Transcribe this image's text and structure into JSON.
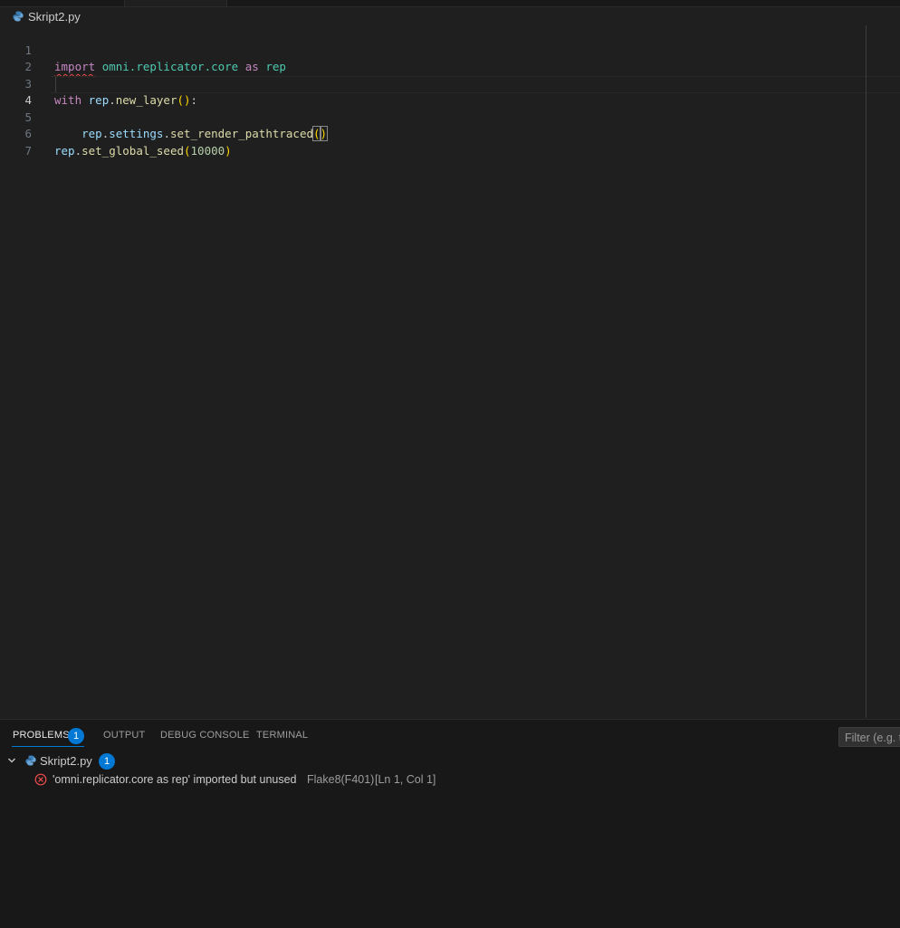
{
  "breadcrumb": {
    "filename": "Skript2.py"
  },
  "editor": {
    "line_numbers": [
      "1",
      "2",
      "3",
      "4",
      "5",
      "6",
      "7"
    ],
    "lines": {
      "l1": {
        "t1": "import",
        "t2": " ",
        "t3": "omni.replicator.core",
        "t4": " ",
        "t5": "as",
        "t6": " ",
        "t7": "rep"
      },
      "l3": {
        "t1": "with",
        "t2": " ",
        "t3": "rep",
        "t4": ".",
        "t5": "new_layer",
        "t6": "()",
        "t7": ":"
      },
      "l4": {
        "t0": "    ",
        "t1": "rep",
        "t2": ".",
        "t3": "settings",
        "t4": ".",
        "t5": "set_render_pathtraced",
        "t6": "(",
        "t7": ")"
      },
      "l6": {
        "t1": "rep",
        "t2": ".",
        "t3": "set_global_seed",
        "t4": "(",
        "t5": "10000",
        "t6": ")"
      }
    }
  },
  "panel": {
    "tabs": {
      "problems": "PROBLEMS",
      "output": "OUTPUT",
      "debug_console": "DEBUG CONSOLE",
      "terminal": "TERMINAL"
    },
    "problems_count": "1",
    "filter_placeholder": "Filter (e.g. text",
    "file_group": {
      "filename": "Skript2.py",
      "count": "1"
    },
    "problem": {
      "message": "'omni.replicator.core as rep' imported but unused",
      "source": "Flake8(F401)",
      "location": "[Ln 1, Col 1]"
    }
  },
  "colors": {
    "accent": "#0078d4",
    "error": "#f14c4c",
    "keyword": "#c586c0",
    "module": "#4ec9b0",
    "variable": "#9cdcfe",
    "function": "#dcdcaa",
    "number": "#b5cea8"
  },
  "icons": {
    "file_icon": "python-file-icon",
    "chevron": "chevron-down-icon",
    "error": "error-circle-icon"
  }
}
